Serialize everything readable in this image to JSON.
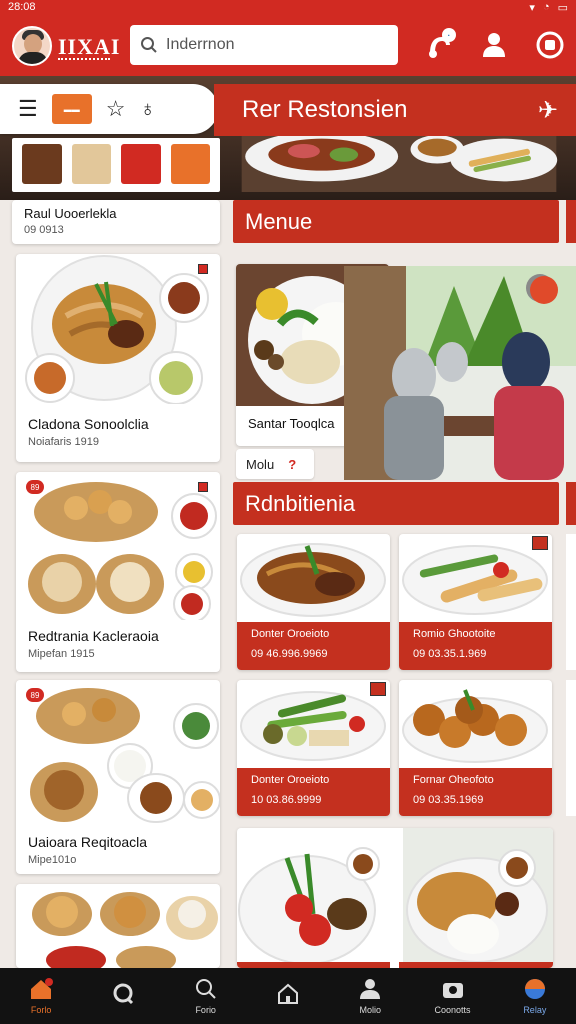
{
  "status": {
    "time": "28:08"
  },
  "header": {
    "logo": "IIXAI",
    "search_placeholder": "Inderrnon",
    "notif_count": "·"
  },
  "hero": {
    "title": "Rer Restonsien"
  },
  "sections": {
    "menu_title": "Menue",
    "restaurant_title": "Rdnbitienia"
  },
  "left_cards": [
    {
      "title": "Raul Uooerlekla",
      "sub": "09 0913"
    },
    {
      "title": "Cladona Sonoolclia",
      "sub": "Noiafaris 1919"
    },
    {
      "title": "Redtrania Kacleraoia",
      "sub": "Mipefan 1915",
      "badge": "89"
    },
    {
      "title": "Uaioara Reqitoacla",
      "sub": "Mipe101o",
      "badge": "89"
    }
  ],
  "menu_card": {
    "title": "Santar Tooqlca"
  },
  "menu_pill": {
    "label": "Molu",
    "mark": "?"
  },
  "price_cards": [
    {
      "title": "Donter Oroeioto",
      "price": "09  46.996.9969"
    },
    {
      "title": "Romio Ghootoite",
      "price": "09  03.35.1.969"
    },
    {
      "title": "Donter Oroeioto",
      "price": "10  03.86.9999"
    },
    {
      "title": "Fornar Oheofoto",
      "price": "09  03.35.1969"
    }
  ],
  "bottom_nav": [
    {
      "label": "Forlo",
      "icon": "home-icon",
      "active": true
    },
    {
      "label": "",
      "icon": "search-bubble-icon"
    },
    {
      "label": "Forio",
      "icon": "search-icon"
    },
    {
      "label": "",
      "icon": "house-outline-icon"
    },
    {
      "label": "Molio",
      "icon": "person-icon"
    },
    {
      "label": "Coonotts",
      "icon": "camera-icon"
    },
    {
      "label": "Relay",
      "icon": "globe-icon"
    }
  ],
  "colors": {
    "primary": "#d12a22",
    "accent": "#e8712a",
    "header_band": "#c4301f"
  }
}
